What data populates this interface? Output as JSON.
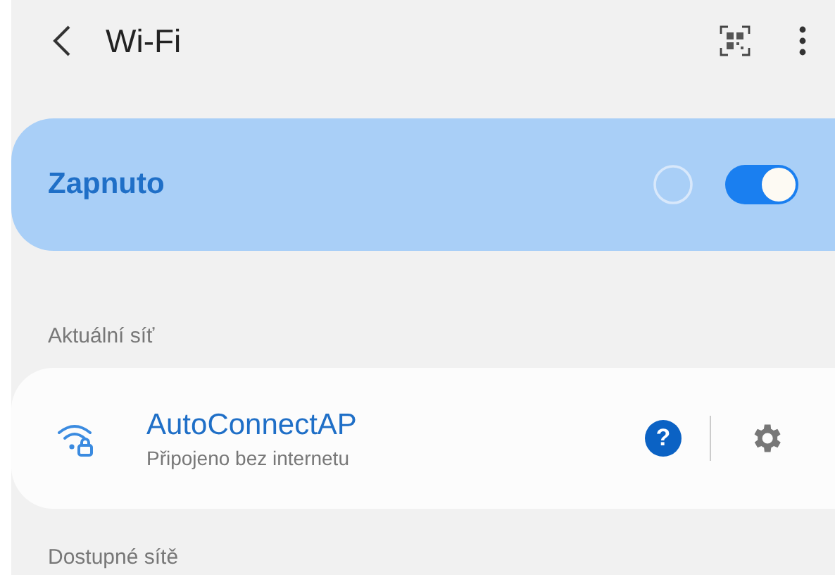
{
  "header": {
    "title": "Wi-Fi"
  },
  "wifi_switch": {
    "label": "Zapnuto",
    "on": true
  },
  "current_section": {
    "title": "Aktuální síť"
  },
  "current_network": {
    "name": "AutoConnectAP",
    "status": "Připojeno bez internetu",
    "help_badge": "?"
  },
  "available_section": {
    "title": "Dostupné sítě"
  }
}
